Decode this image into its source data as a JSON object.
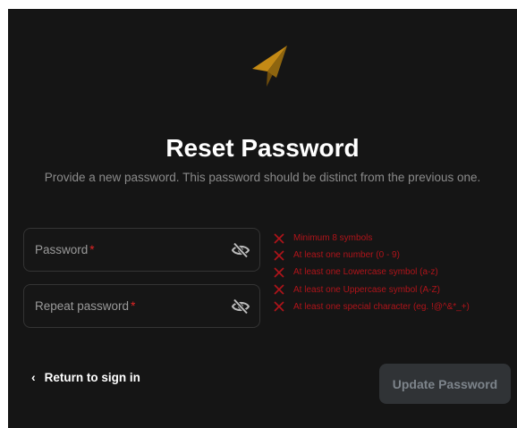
{
  "title": "Reset Password",
  "subtitle": "Provide a new password. This password should be distinct from the previous one.",
  "fields": [
    {
      "label": "Password",
      "required_mark": "*",
      "icon": "eye-off-icon"
    },
    {
      "label": "Repeat password",
      "required_mark": "*",
      "icon": "eye-off-icon"
    }
  ],
  "requirements": [
    "Minimum 8 symbols",
    "At least one number (0 - 9)",
    "At least one Lowercase symbol (a-z)",
    "At least one Uppercase symbol (A-Z)",
    "At least one special character (eg. !@^&*_+)"
  ],
  "back_link": {
    "chevron": "‹",
    "label": "Return to sign in"
  },
  "submit": {
    "label": "Update Password"
  },
  "colors": {
    "background": "#151515",
    "error": "#b0141a",
    "logo": "#c48a15",
    "button_bg": "#303336"
  }
}
